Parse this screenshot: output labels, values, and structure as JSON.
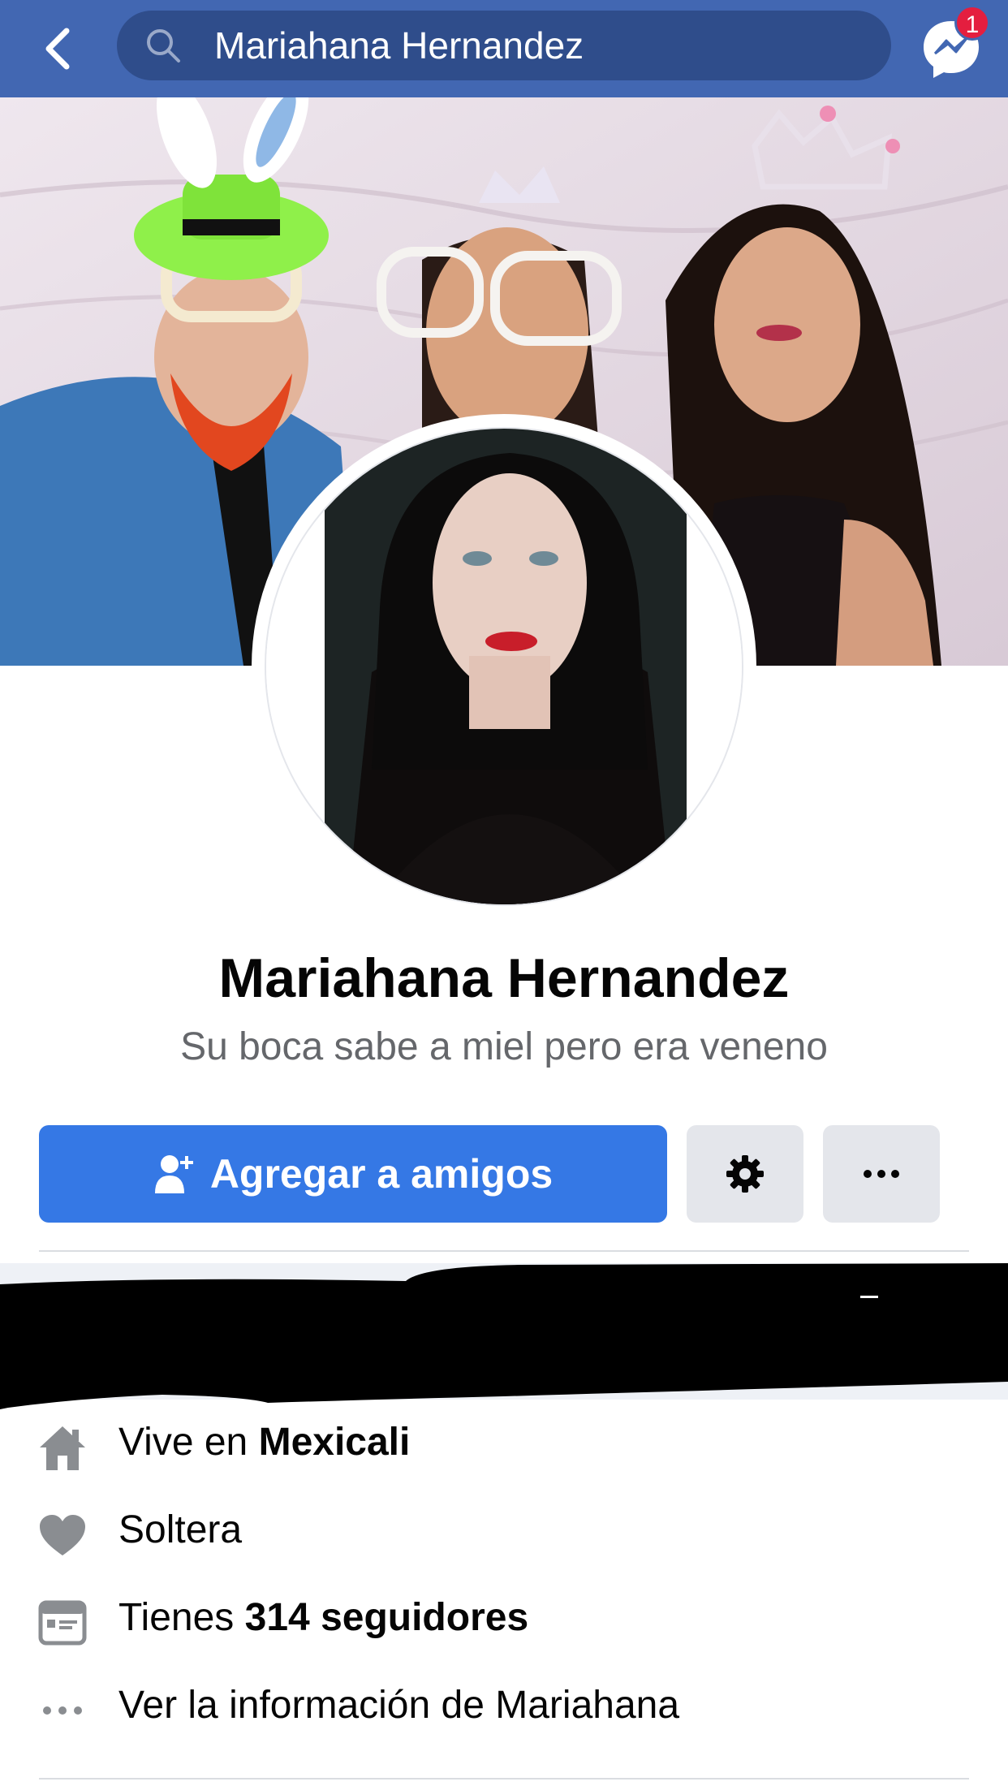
{
  "header": {
    "search_query": "Mariahana Hernandez",
    "messenger_badge": "1"
  },
  "profile": {
    "name": "Mariahana Hernandez",
    "bio": "Su boca sabe a miel pero era veneno"
  },
  "actions": {
    "add_friend_label": "Agregar a amigos"
  },
  "intro": {
    "lives_in_prefix": "Vive en",
    "lives_in_city": "Mexicali",
    "relationship": "Soltera",
    "followers_prefix": "Tienes",
    "followers_count": "314 seguidores",
    "see_about": "Ver la información de Mariahana"
  },
  "colors": {
    "nav_blue": "#4267b2",
    "primary_button": "#3578e5",
    "secondary_button": "#e4e6eb",
    "badge_red": "#e41e3f",
    "icon_grey": "#8a8d91"
  },
  "icons": [
    "back-arrow-icon",
    "search-icon",
    "messenger-icon",
    "add-person-icon",
    "gear-icon",
    "more-dots-icon",
    "home-icon",
    "heart-icon",
    "followers-icon",
    "ellipsis-icon"
  ]
}
